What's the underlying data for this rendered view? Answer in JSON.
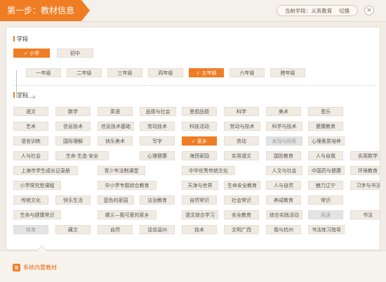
{
  "header": {
    "step_title": "第一步：教材信息",
    "current_stage": "当前学段：义务教育",
    "switch_label": "切换",
    "close_symbol": "×"
  },
  "stage_section": {
    "title": "学段",
    "options": [
      {
        "label": "小学",
        "selected": true
      },
      {
        "label": "初中",
        "selected": false
      }
    ]
  },
  "grade_section": {
    "options": [
      {
        "label": "一年级",
        "selected": false
      },
      {
        "label": "二年级",
        "selected": false
      },
      {
        "label": "三年级",
        "selected": false
      },
      {
        "label": "四年级",
        "selected": false
      },
      {
        "label": "五年级",
        "selected": true
      },
      {
        "label": "六年级",
        "selected": false
      },
      {
        "label": "跨年级",
        "selected": false
      }
    ]
  },
  "subject_section": {
    "title": "学科",
    "rows": [
      [
        {
          "label": "语文"
        },
        {
          "label": "数学"
        },
        {
          "label": "英语"
        },
        {
          "label": "品德与社会"
        },
        {
          "label": "思想品德"
        },
        {
          "label": "科学"
        },
        {
          "label": "美术"
        },
        {
          "label": "音乐"
        }
      ],
      [
        {
          "label": "艺术"
        },
        {
          "label": "信息技术"
        },
        {
          "label": "信息技术基础"
        },
        {
          "label": "劳动技术"
        },
        {
          "label": "科技活动"
        },
        {
          "label": "劳动与技术"
        },
        {
          "label": "科学与技术"
        },
        {
          "label": "健康教育"
        }
      ],
      [
        {
          "label": "语言训练"
        },
        {
          "label": "国际理解"
        },
        {
          "label": "快乐美术"
        },
        {
          "label": "写字"
        },
        {
          "label": "家乡",
          "selected": true
        },
        {
          "label": "劳动"
        },
        {
          "label": "发现与探索",
          "disabled": true
        },
        {
          "label": "心理素质培养"
        }
      ],
      [
        {
          "label": "人与社会"
        },
        {
          "label": "生命·生态·安全"
        },
        {
          "label": "心理健康"
        },
        {
          "label": "海西家园"
        },
        {
          "label": "实用语文"
        },
        {
          "label": "国防教育"
        },
        {
          "label": "人与自我"
        },
        {
          "label": "实用数学"
        }
      ],
      [
        {
          "label": "上海市学生成长记录册"
        },
        {
          "label": "青少年法制课堂"
        },
        {
          "label": "中华优秀传统文化"
        },
        {
          "label": "人文与社会"
        },
        {
          "label": "中国药与健康"
        },
        {
          "label": "环境教育"
        }
      ],
      [
        {
          "label": "小学探究型课程"
        },
        {
          "label": "中小学专题综合教育"
        },
        {
          "label": "天津与世界"
        },
        {
          "label": "生命安全教育"
        },
        {
          "label": "人与自然"
        },
        {
          "label": "魅力辽宁"
        },
        {
          "label": "习字与书法"
        }
      ],
      [
        {
          "label": "传统文化"
        },
        {
          "label": "快乐生活"
        },
        {
          "label": "蓝色的家园"
        },
        {
          "label": "法治教育"
        },
        {
          "label": "自然常识"
        },
        {
          "label": "社会常识"
        },
        {
          "label": "养成教育"
        },
        {
          "label": "常识"
        }
      ],
      [
        {
          "label": "生命与健康常识"
        },
        {
          "label": "顺义—我可爱的家乡"
        },
        {
          "label": "语文综合学习"
        },
        {
          "label": "安全教育"
        },
        {
          "label": "综合实践活动"
        },
        {
          "label": "阅读",
          "disabled": true
        },
        {
          "label": "书法"
        }
      ],
      [
        {
          "label": "体育",
          "disabled": true
        },
        {
          "label": "藏文"
        },
        {
          "label": "自然"
        },
        {
          "label": "话说温州"
        },
        {
          "label": "技术"
        },
        {
          "label": "文明广西"
        },
        {
          "label": "我与杭州"
        },
        {
          "label": "书法练习指导"
        }
      ]
    ]
  },
  "footer": {
    "label": "系统内置教材"
  }
}
